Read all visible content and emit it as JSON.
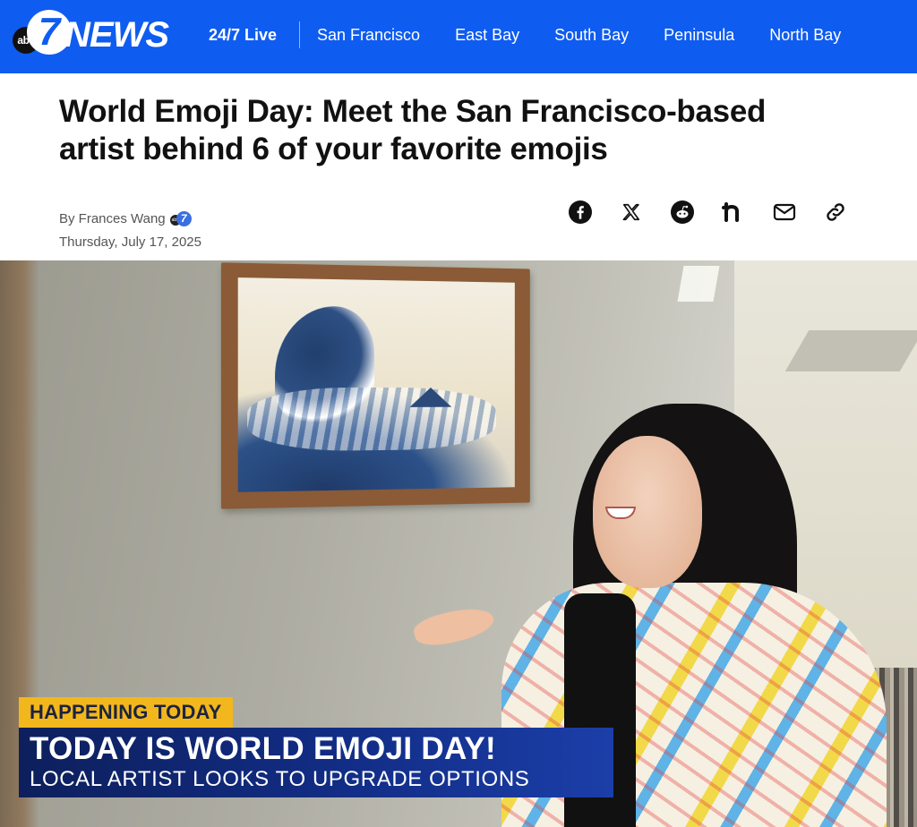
{
  "nav": {
    "logo": {
      "abc": "abc",
      "seven": "7",
      "news": "NEWS"
    },
    "live": "24/7 Live",
    "links": [
      "San Francisco",
      "East Bay",
      "South Bay",
      "Peninsula",
      "North Bay"
    ]
  },
  "article": {
    "headline": "World Emoji Day: Meet the San Francisco-based artist behind 6 of your favorite emojis",
    "byline": "By Frances Wang",
    "date": "Thursday, July 17, 2025"
  },
  "share": {
    "icons": [
      "facebook-icon",
      "x-icon",
      "reddit-icon",
      "nextdoor-icon",
      "email-icon",
      "link-icon"
    ]
  },
  "media": {
    "lower_third": {
      "tag": "HAPPENING TODAY",
      "headline": "TODAY IS WORLD EMOJI DAY!",
      "subline": "LOCAL ARTIST LOOKS TO UPGRADE OPTIONS"
    }
  },
  "colors": {
    "nav_bg": "#0f5cf0",
    "lower_third_tag": "#f2b71c",
    "lower_third_box": "#122d86"
  }
}
